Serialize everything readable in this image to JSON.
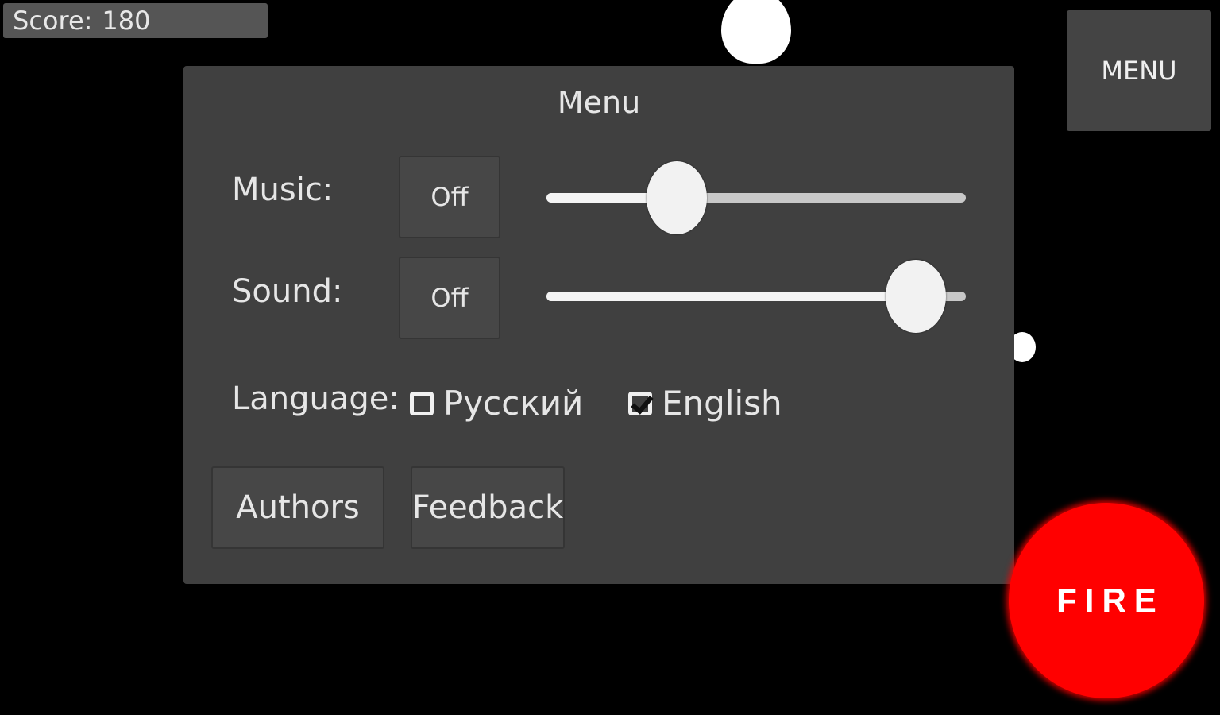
{
  "hud": {
    "score_label": "Score:",
    "score_value": "180",
    "menu_button": "MENU",
    "fire_button": "FIRE"
  },
  "menu": {
    "title": "Menu",
    "music": {
      "label": "Music:",
      "toggle": "Off",
      "volume": 0.31
    },
    "sound": {
      "label": "Sound:",
      "toggle": "Off",
      "volume": 0.88
    },
    "language": {
      "label": "Language:",
      "options": [
        {
          "label": "Русский",
          "checked": false
        },
        {
          "label": "English",
          "checked": true
        }
      ]
    },
    "authors_button": "Authors",
    "feedback_button": "Feedback"
  },
  "colors": {
    "background": "#000000",
    "panel": "#404040",
    "button": "#474747",
    "fire": "#ff0000",
    "text": "#e6e6e6"
  }
}
